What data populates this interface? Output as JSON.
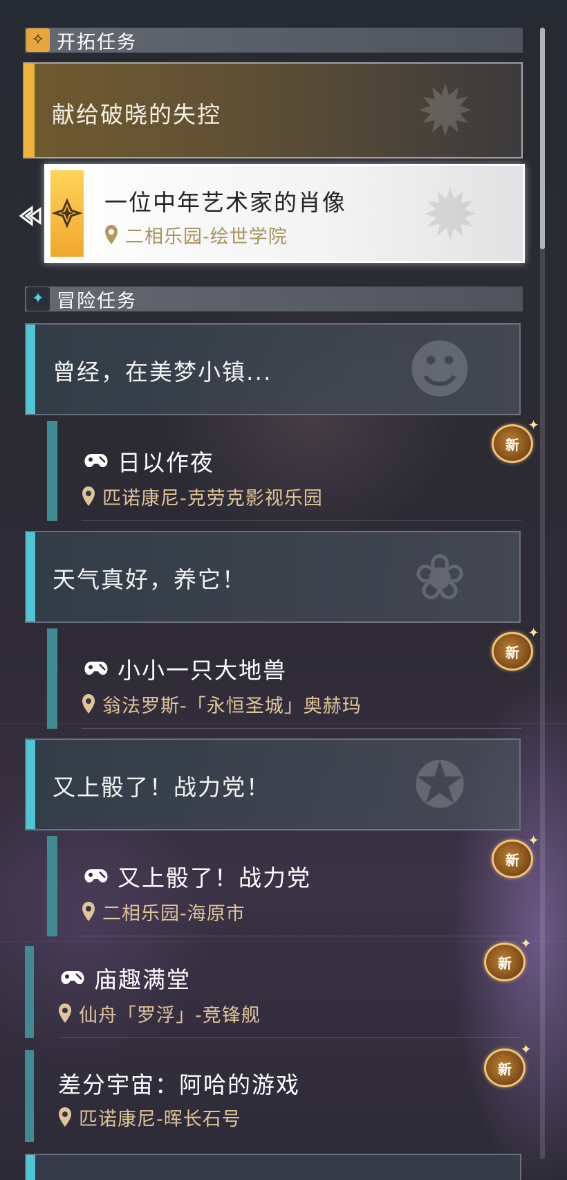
{
  "trailblaze": {
    "header_label": "开拓任务",
    "main_quest_title": "献给破晓的失控",
    "selected_subquest": {
      "name": "一位中年艺术家的肖像",
      "location": "二相乐园-绘世学院"
    }
  },
  "adventure": {
    "header_label": "冒险任务",
    "groups": [
      {
        "title": "曾经，在美梦小镇...",
        "sub": {
          "name": "日以作夜",
          "location": "匹诺康尼-克劳克影视乐园",
          "badge": "新"
        }
      },
      {
        "title": "天气真好，养它！",
        "sub": {
          "name": "小小一只大地兽",
          "location": "翁法罗斯-「永恒圣城」奥赫玛",
          "badge": "新"
        }
      },
      {
        "title": "又上骰了！战力党！",
        "sub": {
          "name": "又上骰了！战力党",
          "location": "二相乐园-海原市",
          "badge": "新"
        }
      }
    ],
    "standalone": [
      {
        "name": "庙趣满堂",
        "location": "仙舟「罗浮」-竞锋舰",
        "badge": "新"
      },
      {
        "name": "差分宇宙：阿哈的游戏",
        "location": "匹诺康尼-晖长石号",
        "badge": "新"
      }
    ]
  },
  "colors": {
    "trailblaze_accent": "#f0b43a",
    "adventure_accent": "#4fc6d8",
    "subquest_bar": "#3f8a93",
    "location_text": "#e0c49a"
  },
  "icons": {
    "trailblaze_header": "four-point-star-icon",
    "adventure_header": "four-point-star-icon",
    "location": "location-pin-icon",
    "quest_type": "adventure-gamepad-icon",
    "tracking": "tracking-arrow-icon"
  }
}
